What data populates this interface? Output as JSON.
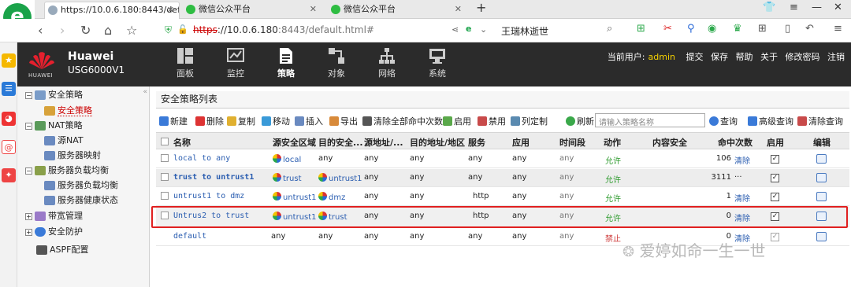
{
  "browser": {
    "tabs": [
      {
        "title": "https://10.0.6.180:8443/default"
      },
      {
        "title": "微信公众平台"
      },
      {
        "title": "微信公众平台"
      }
    ],
    "url_proto": "https",
    "url_host": "://10.0.6.180",
    "url_rest": ":8443/default.html#",
    "search_text": "王瑞林逝世"
  },
  "app": {
    "brand_logo": "HUAWEI",
    "brand": "Huawei",
    "model": "USG6000V1",
    "modules": [
      {
        "label": "面板"
      },
      {
        "label": "监控"
      },
      {
        "label": "策略"
      },
      {
        "label": "对象"
      },
      {
        "label": "网络"
      },
      {
        "label": "系统"
      }
    ],
    "user_label": "当前用户:",
    "user": "admin",
    "links": [
      "提交",
      "保存",
      "帮助",
      "关于",
      "修改密码",
      "注销"
    ]
  },
  "nav": [
    {
      "label": "安全策略"
    },
    {
      "label": "安全策略"
    },
    {
      "label": "NAT策略"
    },
    {
      "label": "源NAT"
    },
    {
      "label": "服务器映射"
    },
    {
      "label": "服务器负载均衡"
    },
    {
      "label": "服务器负载均衡"
    },
    {
      "label": "服务器健康状态"
    },
    {
      "label": "带宽管理"
    },
    {
      "label": "安全防护"
    },
    {
      "label": "ASPF配置"
    }
  ],
  "panel": {
    "title": "安全策略列表",
    "toolbar": {
      "new": "新建",
      "delete": "删除",
      "copy": "复制",
      "move": "移动",
      "insert": "插入",
      "export": "导出",
      "clear_all": "清除全部命中次数",
      "enable": "启用",
      "disable": "禁用",
      "columns": "列定制",
      "refresh": "刷新",
      "search_placeholder": "请输入策略名称",
      "query": "查询",
      "advanced": "高级查询",
      "clear_query": "清除查询"
    },
    "columns": [
      "名称",
      "源安全区域",
      "目的安全...",
      "源地址/...",
      "目的地址/地区",
      "服务",
      "应用",
      "时间段",
      "动作",
      "内容安全",
      "命中次数",
      "启用",
      "编辑"
    ],
    "rows": [
      {
        "name": "local to any",
        "src": "local",
        "dst": "any",
        "srcaddr": "any",
        "dstaddr": "any",
        "service": "any",
        "app": "any",
        "time": "any",
        "action": "允许",
        "hits": "106",
        "clear": "清除"
      },
      {
        "name": "trust to untrust1",
        "src": "trust",
        "dst": "untrust1",
        "srcaddr": "any",
        "dstaddr": "any",
        "service": "any",
        "app": "any",
        "time": "any",
        "action": "允许",
        "hits": "3111",
        "clear": "···"
      },
      {
        "name": "untrust1 to dmz",
        "src": "untrust1",
        "dst": "dmz",
        "srcaddr": "any",
        "dstaddr": "any",
        "service": "http",
        "app": "any",
        "time": "any",
        "action": "允许",
        "hits": "1",
        "clear": "清除"
      },
      {
        "name": "Untrus2 to trust",
        "src": "untrust1",
        "dst": "trust",
        "srcaddr": "any",
        "dstaddr": "any",
        "service": "http",
        "app": "any",
        "time": "any",
        "action": "允许",
        "hits": "0",
        "clear": "清除"
      },
      {
        "name": "default",
        "src": "any",
        "dst": "any",
        "srcaddr": "any",
        "dstaddr": "any",
        "service": "any",
        "app": "any",
        "time": "any",
        "action": "禁止",
        "hits": "0",
        "clear": "清除"
      }
    ]
  },
  "watermark": "爱婷如命一生一世"
}
